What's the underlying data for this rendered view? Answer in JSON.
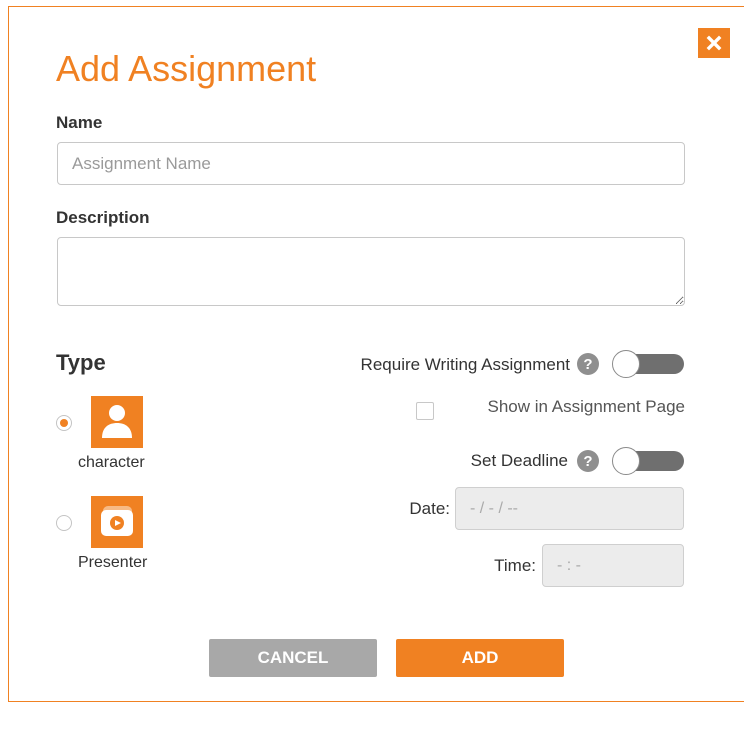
{
  "dialog": {
    "title": "Add Assignment",
    "close_icon": "close-icon"
  },
  "fields": {
    "name_label": "Name",
    "name_placeholder": "Assignment Name",
    "description_label": "Description",
    "description_value": ""
  },
  "type": {
    "title": "Type",
    "options": [
      {
        "label": "character",
        "icon": "person-icon",
        "selected": true
      },
      {
        "label": "Presenter",
        "icon": "video-presenter-icon",
        "selected": false
      }
    ]
  },
  "options": {
    "require_writing_label": "Require Writing Assignment",
    "require_writing_enabled": false,
    "show_in_page_label": "Show in Assignment Page",
    "show_in_page_checked": false,
    "set_deadline_label": "Set Deadline",
    "set_deadline_enabled": false,
    "date_label": "Date:",
    "date_value": "- / - / --",
    "time_label": "Time:",
    "time_value": "- : -",
    "help_glyph": "?"
  },
  "buttons": {
    "cancel": "CANCEL",
    "add": "ADD"
  },
  "colors": {
    "accent": "#f08122",
    "cancel": "#a8a8a8",
    "toggle_track": "#6f6f6f"
  }
}
